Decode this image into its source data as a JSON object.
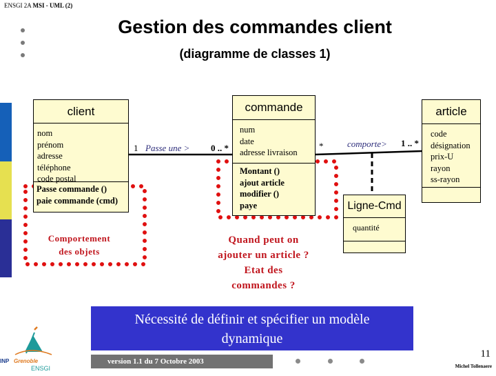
{
  "header": {
    "course_prefix": "ENSGI 2A",
    "course_bold": "MSI - UML (2)"
  },
  "title": "Gestion des commandes client",
  "subtitle": "(diagramme de classes 1)",
  "side_strip_colors": [
    "#1560b8",
    "#e6e050",
    "#2a2f96"
  ],
  "classes": {
    "client": {
      "name": "client",
      "attributes": [
        "nom",
        "prénom",
        "adresse",
        "téléphone",
        "code postal"
      ],
      "operations": [
        "Passe commande ()",
        "paie commande (cmd)"
      ]
    },
    "commande": {
      "name": "commande",
      "attributes": [
        "num",
        "date",
        "adresse livraison"
      ],
      "operations": [
        "Montant ()",
        "ajout article",
        "modifier ()",
        "paye"
      ]
    },
    "article": {
      "name": "article",
      "attributes": [
        "code",
        "désignation",
        "prix-U",
        "rayon",
        "ss-rayon"
      ],
      "operations": []
    },
    "ligne_cmd": {
      "name": "Ligne-Cmd",
      "attributes": [
        "quantité"
      ],
      "operations": []
    }
  },
  "associations": {
    "passe": {
      "client_multiplicity": "1",
      "role": "Passe une >",
      "commande_multiplicity": "0 .. *"
    },
    "comporte": {
      "commande_multiplicity": "*",
      "role": "comporte>",
      "article_multiplicity": "1 .. *"
    }
  },
  "notes": {
    "behavior": [
      "Comportement",
      "des objets"
    ],
    "questions": [
      "Quand peut on",
      "ajouter un article ?",
      "Etat des",
      "commandes ?"
    ]
  },
  "conclusion": [
    "Nécessité de définir et spécifier un modèle",
    "dynamique"
  ],
  "footer": {
    "version": "version 1.1 du 7 Octobre 2003",
    "page_number": "11",
    "author": "Michel Tollenaere",
    "logo_inp": "INP",
    "logo_grenoble": "Grenoble",
    "logo_ensgi": "ENSGI"
  },
  "colors": {
    "class_fill": "#fefbd0",
    "highlight_red": "#e01010",
    "note_red": "#c0141c",
    "conclusion_blue": "#3333cc",
    "version_gray": "#727272",
    "role_text": "#2c2c7a"
  }
}
